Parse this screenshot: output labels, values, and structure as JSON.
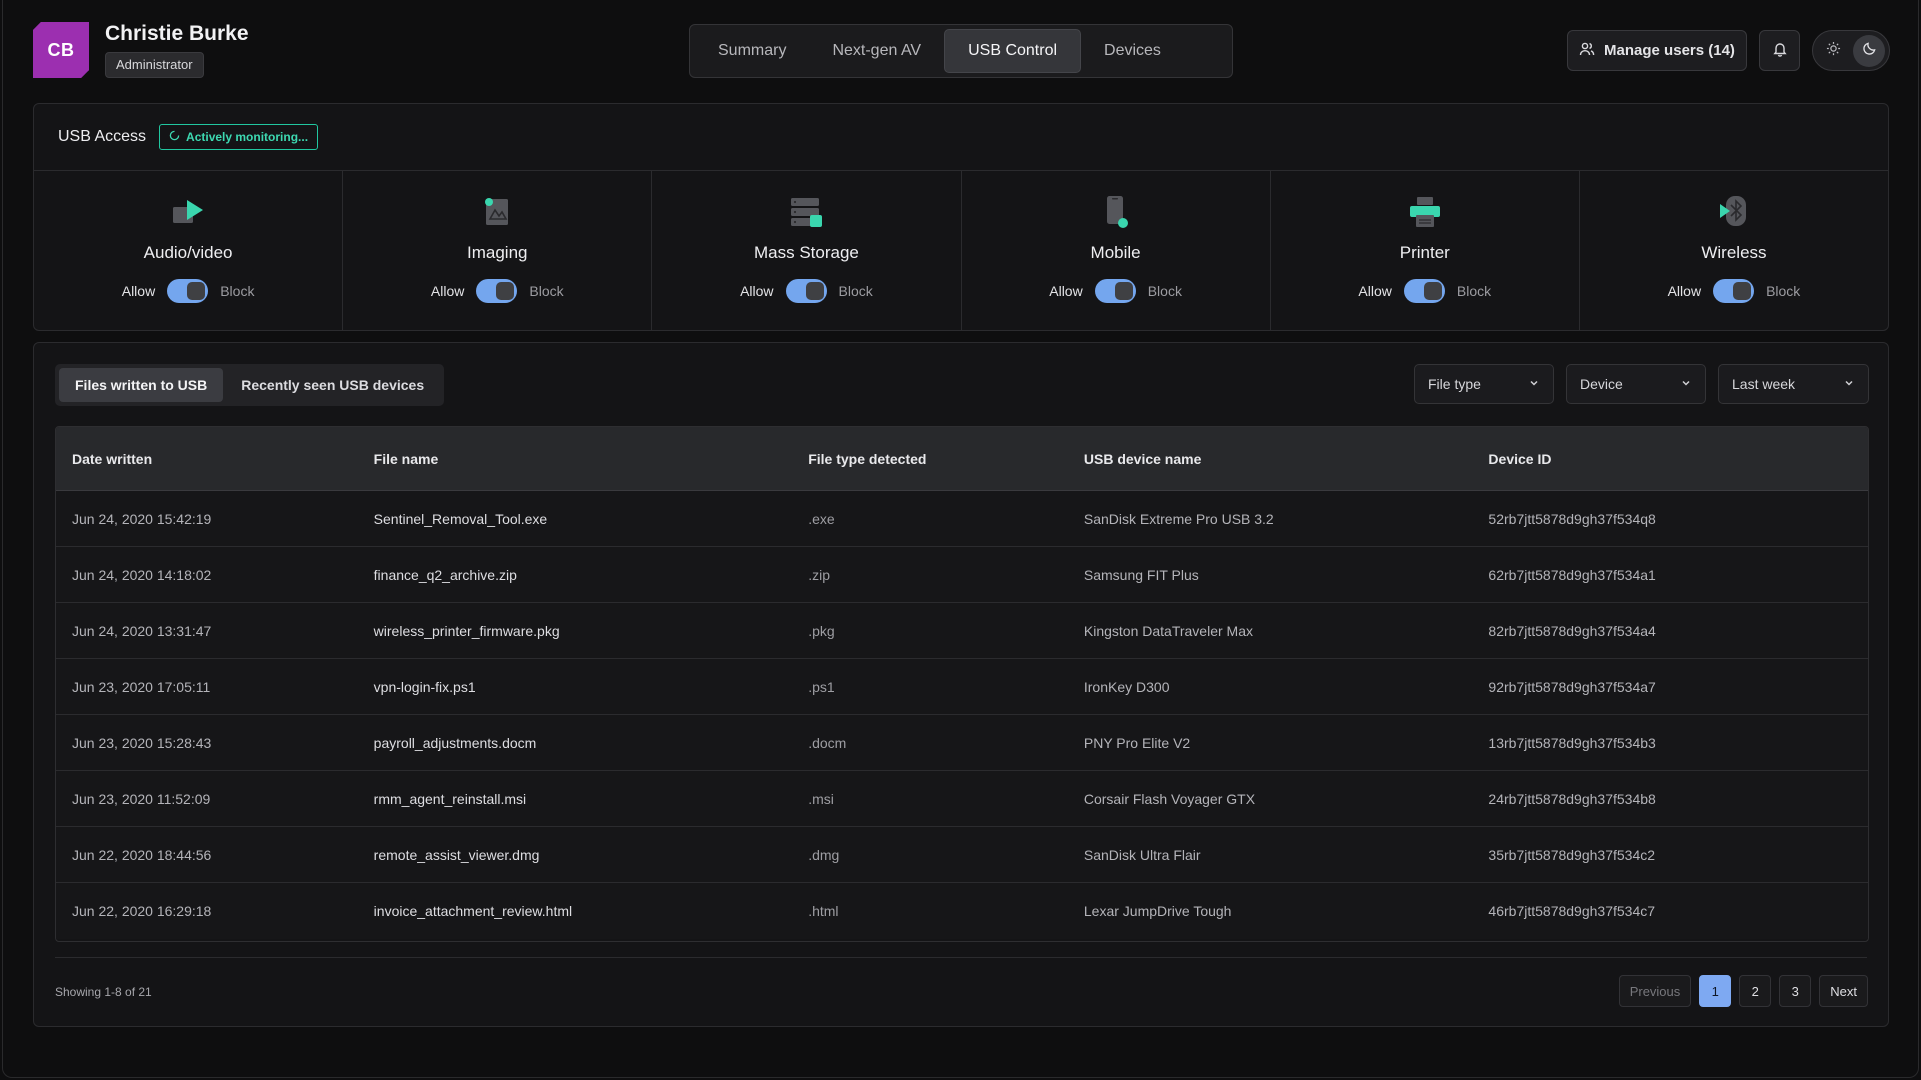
{
  "user": {
    "initials": "CB",
    "name": "Christie Burke",
    "role": "Administrator",
    "avatar_color": "#9c2fb0"
  },
  "nav": {
    "tabs": [
      {
        "label": "Summary",
        "active": false
      },
      {
        "label": "Next-gen AV",
        "active": false
      },
      {
        "label": "USB Control",
        "active": true
      },
      {
        "label": "Devices",
        "active": false
      }
    ]
  },
  "header_actions": {
    "manage_users_label": "Manage users (14)",
    "icons": {
      "manage": "users-icon",
      "notifications": "bell-icon",
      "light": "sun-icon",
      "dark": "moon-icon"
    },
    "theme": "dark"
  },
  "usb_access": {
    "title": "USB Access",
    "status": "Actively monitoring...",
    "status_color": "#21c7a0",
    "allow_label": "Allow",
    "block_label": "Block",
    "categories": [
      {
        "name": "Audio/video",
        "icon": "video-play-icon"
      },
      {
        "name": "Imaging",
        "icon": "image-icon"
      },
      {
        "name": "Mass Storage",
        "icon": "storage-icon"
      },
      {
        "name": "Mobile",
        "icon": "mobile-icon"
      },
      {
        "name": "Printer",
        "icon": "printer-icon"
      },
      {
        "name": "Wireless",
        "icon": "bluetooth-icon"
      }
    ],
    "accent_color": "#3ad6ae",
    "toggle_color": "#74a6ee"
  },
  "files": {
    "segments": [
      {
        "label": "Files written to USB",
        "active": true
      },
      {
        "label": "Recently seen USB devices",
        "active": false
      }
    ],
    "filters": [
      {
        "label": "File type"
      },
      {
        "label": "Device"
      },
      {
        "label": "Last week"
      }
    ],
    "columns": [
      "Date written",
      "File name",
      "File type detected",
      "USB device name",
      "Device ID"
    ],
    "rows": [
      [
        "Jun 24, 2020 15:42:19",
        "Sentinel_Removal_Tool.exe",
        ".exe",
        "SanDisk Extreme Pro USB 3.2",
        "52rb7jtt5878d9gh37f534q8"
      ],
      [
        "Jun 24, 2020 14:18:02",
        "finance_q2_archive.zip",
        ".zip",
        "Samsung FIT Plus",
        "62rb7jtt5878d9gh37f534a1"
      ],
      [
        "Jun 24, 2020 13:31:47",
        "wireless_printer_firmware.pkg",
        ".pkg",
        "Kingston DataTraveler Max",
        "82rb7jtt5878d9gh37f534a4"
      ],
      [
        "Jun 23, 2020 17:05:11",
        "vpn-login-fix.ps1",
        ".ps1",
        "IronKey D300",
        "92rb7jtt5878d9gh37f534a7"
      ],
      [
        "Jun 23, 2020 15:28:43",
        "payroll_adjustments.docm",
        ".docm",
        "PNY Pro Elite V2",
        "13rb7jtt5878d9gh37f534b3"
      ],
      [
        "Jun 23, 2020 11:52:09",
        "rmm_agent_reinstall.msi",
        ".msi",
        "Corsair Flash Voyager GTX",
        "24rb7jtt5878d9gh37f534b8"
      ],
      [
        "Jun 22, 2020 18:44:56",
        "remote_assist_viewer.dmg",
        ".dmg",
        "SanDisk Ultra Flair",
        "35rb7jtt5878d9gh37f534c2"
      ],
      [
        "Jun 22, 2020 16:29:18",
        "invoice_attachment_review.html",
        ".html",
        "Lexar JumpDrive Tough",
        "46rb7jtt5878d9gh37f534c7"
      ]
    ],
    "showing": "Showing 1-8 of 21",
    "pagination": {
      "previous": "Previous",
      "pages": [
        "1",
        "2",
        "3"
      ],
      "current": "1",
      "next": "Next"
    }
  }
}
